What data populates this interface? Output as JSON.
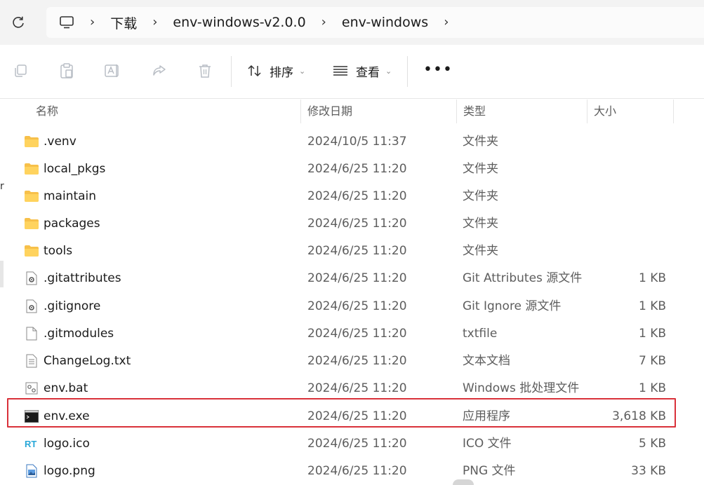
{
  "breadcrumb": [
    "下载",
    "env-windows-v2.0.0",
    "env-windows"
  ],
  "commands": {
    "sort_label": "排序",
    "view_label": "查看"
  },
  "columns": {
    "name": "名称",
    "modified": "修改日期",
    "type": "类型",
    "size": "大小"
  },
  "files": [
    {
      "name": ".venv",
      "modified": "2024/10/5 11:37",
      "type": "文件夹",
      "size": "",
      "icon": "folder-icon"
    },
    {
      "name": "local_pkgs",
      "modified": "2024/6/25 11:20",
      "type": "文件夹",
      "size": "",
      "icon": "folder-icon"
    },
    {
      "name": "maintain",
      "modified": "2024/6/25 11:20",
      "type": "文件夹",
      "size": "",
      "icon": "folder-icon"
    },
    {
      "name": "packages",
      "modified": "2024/6/25 11:20",
      "type": "文件夹",
      "size": "",
      "icon": "folder-icon"
    },
    {
      "name": "tools",
      "modified": "2024/6/25 11:20",
      "type": "文件夹",
      "size": "",
      "icon": "folder-icon"
    },
    {
      "name": ".gitattributes",
      "modified": "2024/6/25 11:20",
      "type": "Git Attributes 源文件",
      "size": "1 KB",
      "icon": "config-file-icon"
    },
    {
      "name": ".gitignore",
      "modified": "2024/6/25 11:20",
      "type": "Git Ignore 源文件",
      "size": "1 KB",
      "icon": "config-file-icon"
    },
    {
      "name": ".gitmodules",
      "modified": "2024/6/25 11:20",
      "type": "txtfile",
      "size": "1 KB",
      "icon": "blank-file-icon"
    },
    {
      "name": "ChangeLog.txt",
      "modified": "2024/6/25 11:20",
      "type": "文本文档",
      "size": "7 KB",
      "icon": "text-file-icon"
    },
    {
      "name": "env.bat",
      "modified": "2024/6/25 11:20",
      "type": "Windows 批处理文件",
      "size": "1 KB",
      "icon": "batch-file-icon"
    },
    {
      "name": "env.exe",
      "modified": "2024/6/25 11:20",
      "type": "应用程序",
      "size": "3,618 KB",
      "icon": "console-app-icon"
    },
    {
      "name": "logo.ico",
      "modified": "2024/6/25 11:20",
      "type": "ICO 文件",
      "size": "5 KB",
      "icon": "rt-logo-icon"
    },
    {
      "name": "logo.png",
      "modified": "2024/6/25 11:20",
      "type": "PNG 文件",
      "size": "33 KB",
      "icon": "image-file-icon"
    }
  ],
  "highlight_color": "#d9313a",
  "folder_color": "#f7c04a"
}
